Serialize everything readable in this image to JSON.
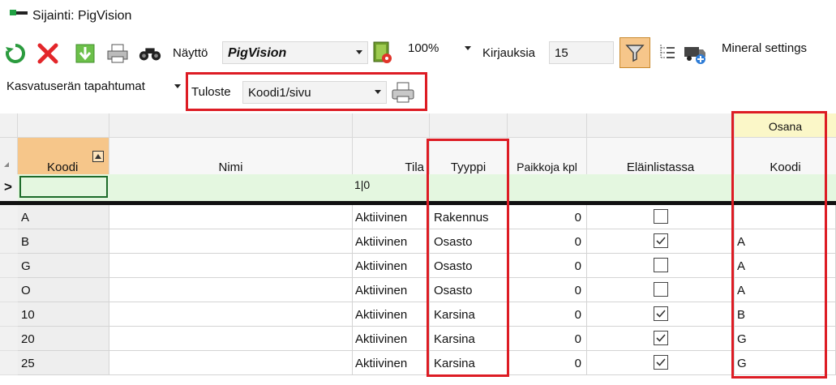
{
  "window": {
    "title": "Sijainti: PigVision"
  },
  "toolbar": {
    "display_label": "Näyttö",
    "display_value": "PigVision",
    "zoom_value": "100%",
    "records_label": "Kirjauksia",
    "records_value": "15",
    "mineral_label": "Mineral settings"
  },
  "toolbar2": {
    "events_label": "Kasvatuserän tapahtumat",
    "print_label": "Tuloste",
    "print_value": "Koodi1/sivu"
  },
  "grid": {
    "group_header": "Osana",
    "columns": [
      "Koodi",
      "Nimi",
      "Tila",
      "Tyyppi",
      "Paikkoja kpl",
      "Eläinlistassa",
      "Koodi"
    ],
    "filter_row": {
      "tila": "1|0",
      "current_row_marker": ">"
    },
    "rows": [
      {
        "koodi": "A",
        "nimi": "",
        "tila": "Aktiivinen",
        "tyyppi": "Rakennus",
        "paikkoja": "0",
        "elain": false,
        "osana": ""
      },
      {
        "koodi": "B",
        "nimi": "",
        "tila": "Aktiivinen",
        "tyyppi": "Osasto",
        "paikkoja": "0",
        "elain": true,
        "osana": "A"
      },
      {
        "koodi": "G",
        "nimi": "",
        "tila": "Aktiivinen",
        "tyyppi": "Osasto",
        "paikkoja": "0",
        "elain": false,
        "osana": "A"
      },
      {
        "koodi": "O",
        "nimi": "",
        "tila": "Aktiivinen",
        "tyyppi": "Osasto",
        "paikkoja": "0",
        "elain": false,
        "osana": "A"
      },
      {
        "koodi": "10",
        "nimi": "",
        "tila": "Aktiivinen",
        "tyyppi": "Karsina",
        "paikkoja": "0",
        "elain": true,
        "osana": "B"
      },
      {
        "koodi": "20",
        "nimi": "",
        "tila": "Aktiivinen",
        "tyyppi": "Karsina",
        "paikkoja": "0",
        "elain": true,
        "osana": "G"
      },
      {
        "koodi": "25",
        "nimi": "",
        "tila": "Aktiivinen",
        "tyyppi": "Karsina",
        "paikkoja": "0",
        "elain": true,
        "osana": "G"
      }
    ]
  },
  "colors": {
    "highlight": "#dd1c24",
    "sort_header": "#f6c68a",
    "filter_row": "#e4f7e0",
    "group_header": "#fbf7c8"
  }
}
